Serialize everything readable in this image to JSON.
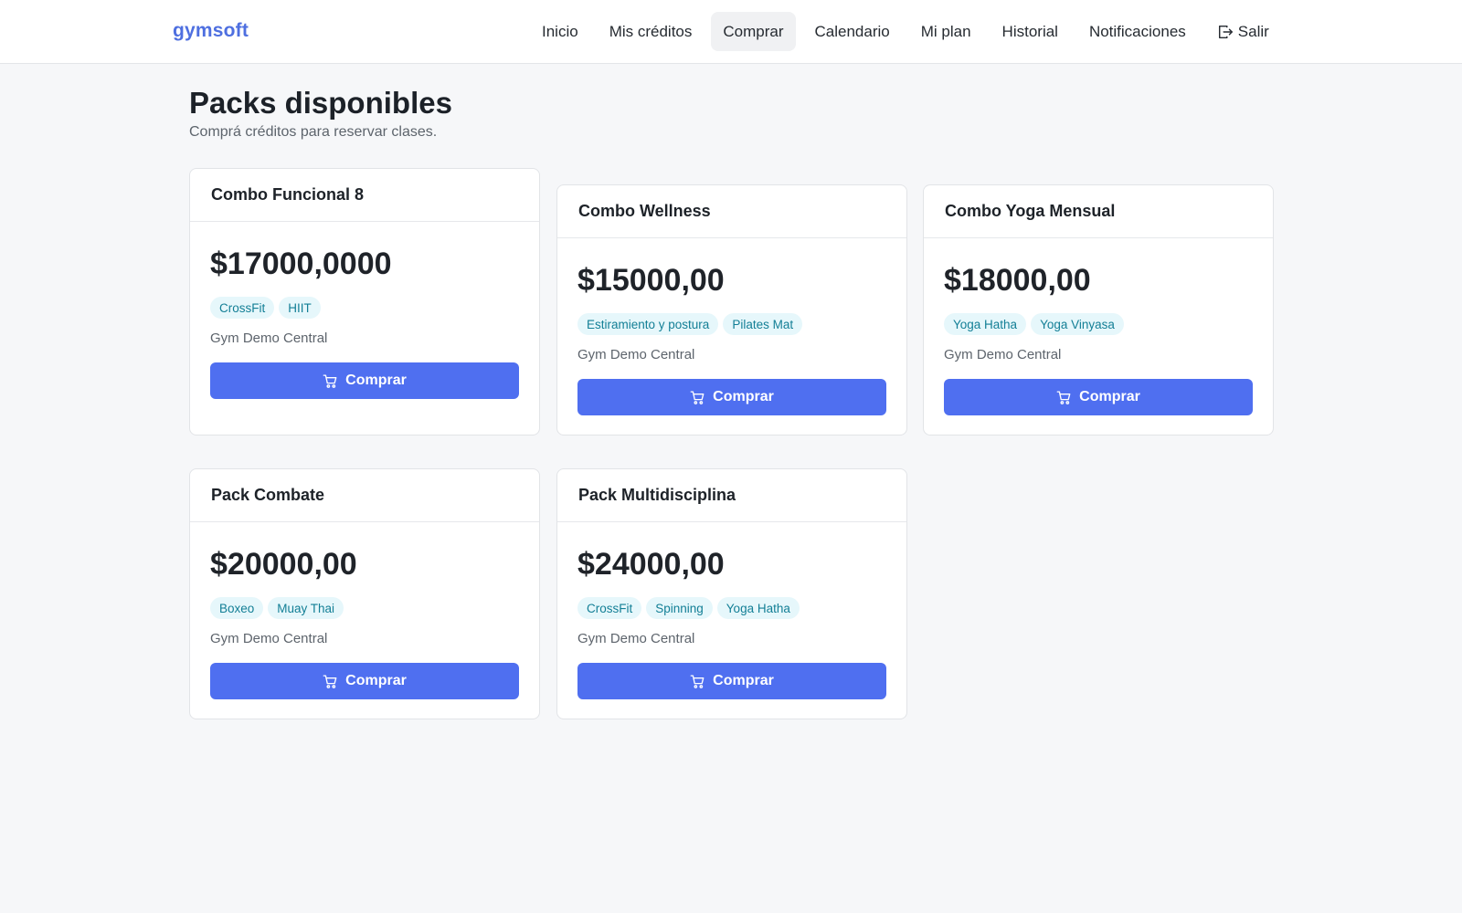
{
  "brand": "gymsoft",
  "nav": {
    "items": [
      "Inicio",
      "Mis créditos",
      "Comprar",
      "Calendario",
      "Mi plan",
      "Historial",
      "Notificaciones"
    ],
    "active": "Comprar",
    "logout_label": "Salir",
    "logout_icon": "logout-icon"
  },
  "header": {
    "title": "Packs disponibles",
    "subtitle": "Comprá créditos para reservar clases."
  },
  "packs": [
    {
      "name": "Combo Funcional 8",
      "price": "$17000,0000",
      "tags": [
        "CrossFit",
        "HIIT"
      ],
      "gym": "Gym Demo Central",
      "button_label": "Comprar"
    },
    {
      "name": "Combo Wellness",
      "price": "$15000,00",
      "tags": [
        "Estiramiento y postura",
        "Pilates Mat"
      ],
      "gym": "Gym Demo Central",
      "button_label": "Comprar"
    },
    {
      "name": "Combo Yoga Mensual",
      "price": "$18000,00",
      "tags": [
        "Yoga Hatha",
        "Yoga Vinyasa"
      ],
      "gym": "Gym Demo Central",
      "button_label": "Comprar"
    },
    {
      "name": "Pack Combate",
      "price": "$20000,00",
      "tags": [
        "Boxeo",
        "Muay Thai"
      ],
      "gym": "Gym Demo Central",
      "button_label": "Comprar"
    },
    {
      "name": "Pack Multidisciplina",
      "price": "$24000,00",
      "tags": [
        "CrossFit",
        "Spinning",
        "Yoga Hatha"
      ],
      "gym": "Gym Demo Central",
      "button_label": "Comprar"
    }
  ],
  "colors": {
    "brand": "#4e6fe0",
    "button": "#4f6ff0",
    "tag_bg": "#e6f7fb",
    "tag_text": "#137f96",
    "page_bg": "#f6f7f9"
  }
}
